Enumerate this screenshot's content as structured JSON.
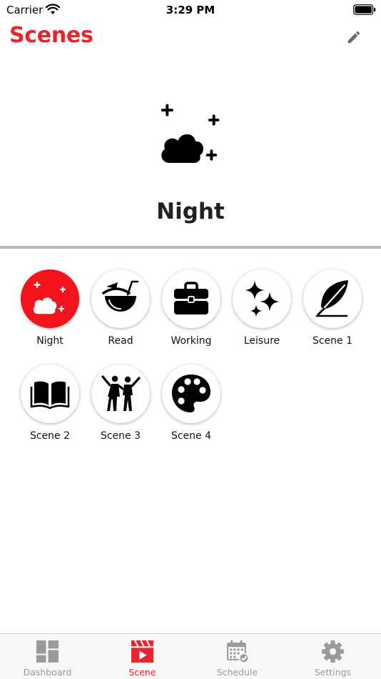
{
  "status_bar": {
    "carrier": "Carrier",
    "time": "3:29 PM"
  },
  "nav": {
    "title": "Scenes",
    "edit_icon": "pencil-icon"
  },
  "current_scene": {
    "name": "Night",
    "icon": "moon-cloud-icon"
  },
  "scenes": [
    {
      "label": "Night",
      "icon": "moon-cloud-icon",
      "active": true
    },
    {
      "label": "Read",
      "icon": "coconut-drink-icon",
      "active": false
    },
    {
      "label": "Working",
      "icon": "briefcase-icon",
      "active": false
    },
    {
      "label": "Leisure",
      "icon": "sparkles-icon",
      "active": false
    },
    {
      "label": "Scene 1",
      "icon": "feather-icon",
      "active": false
    },
    {
      "label": "Scene 2",
      "icon": "open-book-icon",
      "active": false
    },
    {
      "label": "Scene 3",
      "icon": "dancing-people-icon",
      "active": false
    },
    {
      "label": "Scene 4",
      "icon": "palette-icon",
      "active": false
    }
  ],
  "tabs": [
    {
      "label": "Dashboard",
      "icon": "dashboard-icon",
      "active": false
    },
    {
      "label": "Scene",
      "icon": "clapperboard-icon",
      "active": true
    },
    {
      "label": "Schedule",
      "icon": "calendar-icon",
      "active": false
    },
    {
      "label": "Settings",
      "icon": "gear-icon",
      "active": false
    }
  ],
  "colors": {
    "accent": "#e8252c",
    "active_circle": "#f4121b",
    "inactive_tab": "#9a9a9a"
  }
}
